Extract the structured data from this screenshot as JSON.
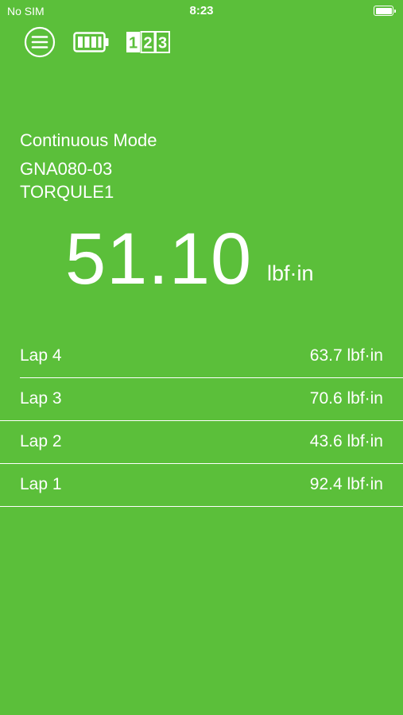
{
  "status_bar": {
    "carrier": "No SIM",
    "time": "8:23"
  },
  "toolbar": {
    "menu_icon": "hamburger-menu-icon",
    "battery_icon": "battery-full-icon",
    "counter_icon": "counter-123-icon",
    "counter_text": "123"
  },
  "info": {
    "mode": "Continuous Mode",
    "device_id": "GNA080-03",
    "device_name": "TORQULE1"
  },
  "reading": {
    "value": "51.10",
    "unit": "lbf·in"
  },
  "laps": [
    {
      "label": "Lap 4",
      "value": "63.7 lbf·in"
    },
    {
      "label": "Lap 3",
      "value": "70.6 lbf·in"
    },
    {
      "label": "Lap 2",
      "value": "43.6 lbf·in"
    },
    {
      "label": "Lap 1",
      "value": "92.4 lbf·in"
    }
  ],
  "colors": {
    "background": "#5bbf3a",
    "foreground": "#ffffff"
  }
}
